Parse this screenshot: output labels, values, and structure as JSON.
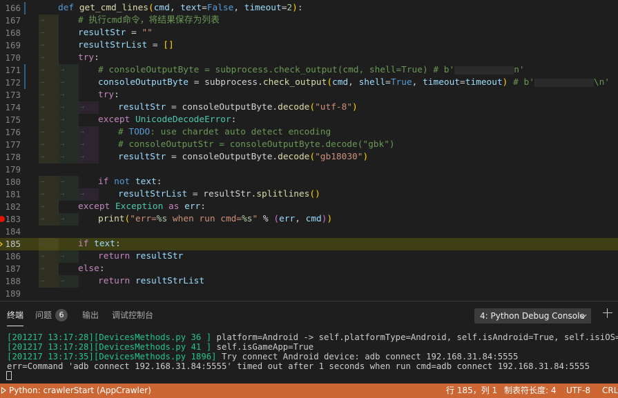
{
  "editor": {
    "current_line": "185",
    "lines": [
      {
        "n": "166",
        "parts": [
          [
            "kw",
            "def "
          ],
          [
            "fn",
            "get_cmd_lines"
          ],
          [
            "par",
            "("
          ],
          [
            "var",
            "cmd"
          ],
          [
            "",
            ","
          ],
          [
            "var",
            " text"
          ],
          [
            "",
            "="
          ],
          [
            "kw",
            "False"
          ],
          [
            "",
            ", "
          ],
          [
            "var",
            "timeout"
          ],
          [
            "",
            "="
          ],
          [
            "num",
            "2"
          ],
          [
            "par",
            ")"
          ],
          [
            "",
            ":"
          ]
        ]
      },
      {
        "n": "167",
        "parts": [
          [
            "cm",
            "# 执行cmd命令，将结果保存为列表"
          ]
        ]
      },
      {
        "n": "168",
        "parts": [
          [
            "var",
            "resultStr"
          ],
          [
            "",
            " = "
          ],
          [
            "str",
            "\"\""
          ]
        ]
      },
      {
        "n": "169",
        "parts": [
          [
            "var",
            "resultStrList"
          ],
          [
            "",
            " = "
          ],
          [
            "brk",
            "[]"
          ]
        ]
      },
      {
        "n": "170",
        "parts": [
          [
            "kw2",
            "try"
          ],
          [
            "",
            ":"
          ]
        ]
      },
      {
        "n": "171",
        "parts": [
          [
            "cm",
            "# consoleOutputByte = subprocess.check_output(cmd, shell=True) # b'"
          ],
          [
            "blur",
            ""
          ],
          [
            "cm",
            "n'"
          ]
        ]
      },
      {
        "n": "172",
        "parts": [
          [
            "var",
            "consoleOutputByte"
          ],
          [
            "",
            " = subprocess."
          ],
          [
            "fn",
            "check_output"
          ],
          [
            "par",
            "("
          ],
          [
            "var",
            "cmd"
          ],
          [
            "",
            ", "
          ],
          [
            "var",
            "shell"
          ],
          [
            "",
            "="
          ],
          [
            "kw",
            "True"
          ],
          [
            "",
            ", "
          ],
          [
            "var",
            "timeout"
          ],
          [
            "",
            "="
          ],
          [
            "var",
            "timeout"
          ],
          [
            "par",
            ")"
          ],
          [
            "cm",
            " # b'"
          ],
          [
            "blur",
            ""
          ],
          [
            "cm",
            "\\n'"
          ]
        ]
      },
      {
        "n": "173",
        "parts": [
          [
            "kw2",
            "try"
          ],
          [
            "",
            ":"
          ]
        ]
      },
      {
        "n": "174",
        "parts": [
          [
            "var",
            "resultStr"
          ],
          [
            "",
            " = consoleOutputByte."
          ],
          [
            "fn",
            "decode"
          ],
          [
            "par",
            "("
          ],
          [
            "str",
            "\"utf-8\""
          ],
          [
            "par",
            ")"
          ]
        ]
      },
      {
        "n": "175",
        "parts": [
          [
            "kw2",
            "except "
          ],
          [
            "cls",
            "UnicodeDecodeError"
          ],
          [
            "",
            ":"
          ]
        ]
      },
      {
        "n": "176",
        "parts": [
          [
            "cm",
            "# "
          ],
          [
            "kw",
            "TODO"
          ],
          [
            "cm",
            ": use chardet auto detect encoding"
          ]
        ]
      },
      {
        "n": "177",
        "parts": [
          [
            "cm",
            "# consoleOutputStr = consoleOutputByte.decode(\"gbk\")"
          ]
        ]
      },
      {
        "n": "178",
        "parts": [
          [
            "var",
            "resultStr"
          ],
          [
            "",
            " = consoleOutputByte."
          ],
          [
            "fn",
            "decode"
          ],
          [
            "par",
            "("
          ],
          [
            "str",
            "\"gb18030\""
          ],
          [
            "par",
            ")"
          ]
        ]
      },
      {
        "n": "179",
        "parts": []
      },
      {
        "n": "180",
        "parts": [
          [
            "kw2",
            "if "
          ],
          [
            "kw",
            "not "
          ],
          [
            "var",
            "text"
          ],
          [
            "",
            ":"
          ]
        ]
      },
      {
        "n": "181",
        "parts": [
          [
            "var",
            "resultStrList"
          ],
          [
            "",
            " = resultStr."
          ],
          [
            "fn",
            "splitlines"
          ],
          [
            "par",
            "()"
          ]
        ]
      },
      {
        "n": "182",
        "parts": [
          [
            "kw2",
            "except "
          ],
          [
            "cls",
            "Exception"
          ],
          [
            "kw2",
            " as "
          ],
          [
            "var",
            "err"
          ],
          [
            "",
            ":"
          ]
        ]
      },
      {
        "n": "183",
        "parts": [
          [
            "fn",
            "print"
          ],
          [
            "par",
            "("
          ],
          [
            "str",
            "\"err="
          ],
          [
            "num",
            "%s"
          ],
          [
            "str",
            " when run cmd="
          ],
          [
            "num",
            "%s"
          ],
          [
            "str",
            "\""
          ],
          [
            "",
            " % "
          ],
          [
            "par2",
            "("
          ],
          [
            "var",
            "err"
          ],
          [
            "",
            ", "
          ],
          [
            "var",
            "cmd"
          ],
          [
            "par2",
            ")"
          ],
          [
            "par",
            ")"
          ]
        ]
      },
      {
        "n": "184",
        "parts": []
      },
      {
        "n": "185",
        "parts": [
          [
            "kw2",
            "if "
          ],
          [
            "var",
            "text"
          ],
          [
            "",
            ":"
          ]
        ]
      },
      {
        "n": "186",
        "parts": [
          [
            "kw2",
            "return "
          ],
          [
            "var",
            "resultStr"
          ]
        ]
      },
      {
        "n": "187",
        "parts": [
          [
            "kw2",
            "else"
          ],
          [
            "",
            ":"
          ]
        ]
      },
      {
        "n": "188",
        "parts": [
          [
            "kw2",
            "return "
          ],
          [
            "var",
            "resultStrList"
          ]
        ]
      },
      {
        "n": "189",
        "parts": []
      }
    ]
  },
  "panel": {
    "tabs": {
      "terminal": "终端",
      "problems": "问题",
      "problems_count": "6",
      "output": "输出",
      "debug_console": "调试控制台"
    },
    "console_select": "4: Python Debug Console",
    "terminal_lines": [
      {
        "prefix": "[201217 13:17:28][DevicesMethods.py 36 ]",
        "text": " platform=Android -> self.platformType=Android, self.isAndroid=True, self.isiOS=False"
      },
      {
        "prefix": "[201217 13:17:28][DevicesMethods.py 41 ]",
        "text": " self.isGameApp=True"
      },
      {
        "prefix": "[201217 13:17:35][DevicesMethods.py 1896]",
        "text": " Try connect Android device: adb connect 192.168.31.84:5555"
      },
      {
        "prefix": "",
        "text": "err=Command 'adb connect 192.168.31.84:5555' timed out after 1 seconds when run cmd=adb connect 192.168.31.84:5555"
      }
    ]
  },
  "status": {
    "debug": "Python: crawlerStart (AppCrawler)",
    "position": "行 185，列 1",
    "tab_size": "制表符长度: 4",
    "encoding": "UTF-8",
    "eol": "CRLF"
  },
  "colors": {
    "status_bar": "#cc6633",
    "current_line": "#3f3f15",
    "breakpoint": "#e51400"
  }
}
